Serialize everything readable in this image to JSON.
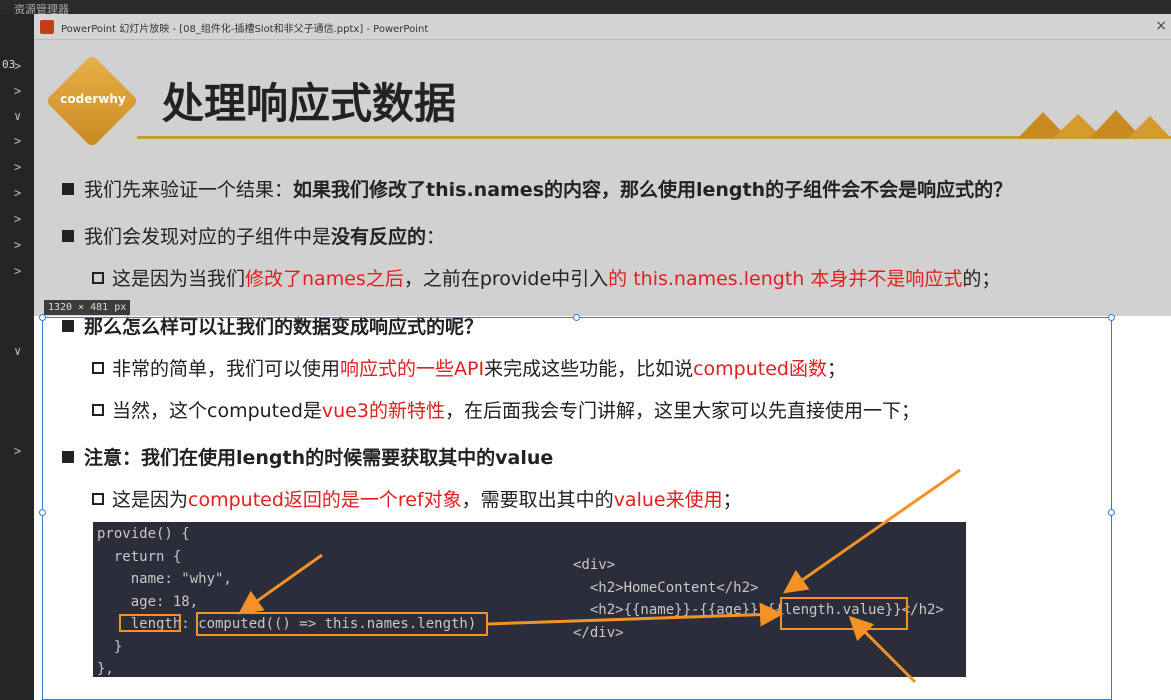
{
  "background_editor": {
    "tab_text": "资源管理器",
    "line_number": "03",
    "gutter_chevrons": [
      ">",
      ">",
      "∨",
      ">",
      ">",
      ">",
      ">",
      ">",
      ">",
      "∨",
      ">"
    ]
  },
  "window": {
    "title": "PowerPoint 幻灯片放映 - [08_组件化-插槽Slot和非父子通信.pptx] - PowerPoint",
    "close": "×"
  },
  "selection_badge": "1320 × 481  px",
  "slide": {
    "logo": "coderwhy",
    "title": "处理响应式数据",
    "bullets": [
      {
        "level": 1,
        "parts": [
          {
            "text": "我们先来验证一个结果：",
            "style": "normal"
          },
          {
            "text": "如果我们修改了this.names的内容，那么使用length的子组件会不会是响应式的？",
            "style": "bold"
          }
        ]
      },
      {
        "level": 1,
        "parts": [
          {
            "text": "我们会发现对应的子组件中是",
            "style": "normal"
          },
          {
            "text": "没有反应的",
            "style": "bold"
          },
          {
            "text": "：",
            "style": "normal"
          }
        ]
      },
      {
        "level": 2,
        "parts": [
          {
            "text": "这是因为当我们",
            "style": "normal"
          },
          {
            "text": "修改了names之后",
            "style": "red"
          },
          {
            "text": "，之前在provide中引入",
            "style": "normal"
          },
          {
            "text": "的 this.names.length 本身并不是响应式",
            "style": "red"
          },
          {
            "text": "的；",
            "style": "normal"
          }
        ]
      },
      {
        "level": 1,
        "parts": [
          {
            "text": "那么怎么样可以让我们的数据变成响应式的呢？",
            "style": "bold"
          }
        ]
      },
      {
        "level": 2,
        "parts": [
          {
            "text": "非常的简单，我们可以使用",
            "style": "normal"
          },
          {
            "text": "响应式的一些API",
            "style": "red"
          },
          {
            "text": "来完成这些功能，比如说",
            "style": "normal"
          },
          {
            "text": "computed函数",
            "style": "red"
          },
          {
            "text": "；",
            "style": "normal"
          }
        ]
      },
      {
        "level": 2,
        "parts": [
          {
            "text": "当然，这个computed是",
            "style": "normal"
          },
          {
            "text": "vue3的新特性",
            "style": "red"
          },
          {
            "text": "，在后面我会专门讲解，这里大家可以先直接使用一下；",
            "style": "normal"
          }
        ]
      },
      {
        "level": 1,
        "parts": [
          {
            "text": "注意：我们在使用length的时候需要获取其中的value",
            "style": "bold"
          }
        ]
      },
      {
        "level": 2,
        "parts": [
          {
            "text": "这是因为",
            "style": "normal"
          },
          {
            "text": "computed返回的是一个ref对象",
            "style": "red"
          },
          {
            "text": "，需要取出其中的",
            "style": "normal"
          },
          {
            "text": "value来使用",
            "style": "red"
          },
          {
            "text": "；",
            "style": "normal"
          }
        ]
      }
    ],
    "code_left": [
      "provide() {",
      "  return {",
      "    name: \"why\",",
      "    age: 18,",
      "    length: computed(() => this.names.length)",
      "  }",
      "},"
    ],
    "code_right": [
      "<div>",
      "  <h2>HomeContent</h2>",
      "  <h2>{{name}}-{{age}}-{{length.value}}</h2>",
      "</div>"
    ]
  },
  "colors": {
    "accent_orange": "#f29227",
    "red_text": "#e02020",
    "title_line": "#c89a3a",
    "selection_blue": "#3a7bd5"
  }
}
